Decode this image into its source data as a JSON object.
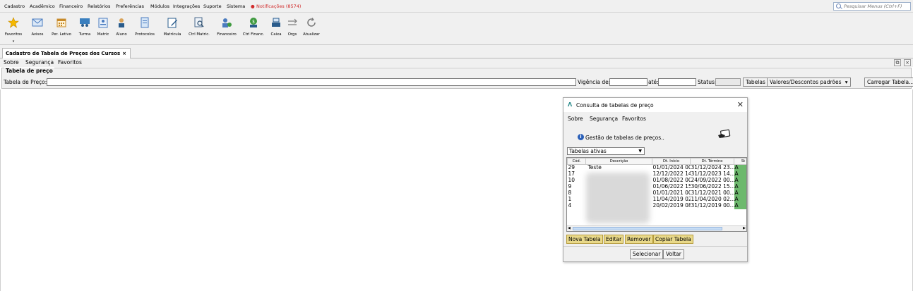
{
  "menubar": {
    "items": [
      "Cadastro",
      "Acadêmico",
      "Financeiro",
      "Relatórios",
      "Preferências",
      "Módulos",
      "Integrações",
      "Suporte",
      "Sistema"
    ],
    "notifications": "Notificações (8574)",
    "search_placeholder": "Pesquisar Menus (Ctrl+F)",
    "notif_color": "#d12b2b"
  },
  "toolbar": {
    "favoritos": "Favoritos",
    "avisos": "Avisos",
    "per_letivo": "Per. Letivo",
    "turma": "Turma",
    "matric": "Matric",
    "aluno": "Aluno",
    "protocolos": "Protocolos",
    "matricula": "Matrícula",
    "ctrl_matric": "Ctrl Matric.",
    "financeiro": "Financeiro",
    "ctrl_financ": "Ctrl Financ.",
    "caixa": "Caixa",
    "orgs": "Orgs",
    "atualizar": "Atualizar"
  },
  "tab": {
    "label": "Cadastro de Tabela de Preços dos Cursos",
    "close": "×"
  },
  "formmenu": {
    "sobre": "Sobre",
    "seguranca": "Segurança",
    "favoritos": "Favoritos"
  },
  "fieldset": {
    "title": "Tabela de preço",
    "tabela_label": "Tabela de Preço:",
    "vigencia_label": "Vigência de:",
    "ate_label": "até:",
    "status_label": "Status:",
    "tabelas_btn": "Tabelas",
    "valores_btn": "Valores/Descontos padrões",
    "carregar_btn": "Carregar Tabela..."
  },
  "dialog": {
    "title": "Consulta de tabelas de preço",
    "menu": {
      "sobre": "Sobre",
      "seguranca": "Segurança",
      "favoritos": "Favoritos"
    },
    "info": "Gestão de tabelas de preços..",
    "filter": "Tabelas ativas",
    "columns": [
      "Cód.",
      "Descrição",
      "Dt. Início",
      "Dt. Término",
      "St"
    ],
    "rows": [
      {
        "cod": "29",
        "desc": "Teste",
        "inicio": "01/01/2024 00...",
        "termino": "31/12/2024 23...",
        "st": "A"
      },
      {
        "cod": "17",
        "desc": "",
        "inicio": "12/12/2022 14...",
        "termino": "31/12/2023 14...",
        "st": "A"
      },
      {
        "cod": "10",
        "desc": "",
        "inicio": "01/08/2022 00...",
        "termino": "24/09/2022 00...",
        "st": "A"
      },
      {
        "cod": "9",
        "desc": "",
        "inicio": "01/06/2022 15...",
        "termino": "30/06/2022 15...",
        "st": "A"
      },
      {
        "cod": "8",
        "desc": "",
        "inicio": "01/01/2021 00...",
        "termino": "31/12/2021 00...",
        "st": "A"
      },
      {
        "cod": "1",
        "desc": "",
        "inicio": "11/04/2019 02...",
        "termino": "11/04/2020 02...",
        "st": "A"
      },
      {
        "cod": "4",
        "desc": "",
        "inicio": "20/02/2019 08...",
        "termino": "31/12/2019 00...",
        "st": "A"
      }
    ],
    "buttons": {
      "nova": "Nova Tabela",
      "editar": "Editar",
      "remover": "Remover",
      "copiar": "Copiar Tabela"
    },
    "selecionar": "Selecionar",
    "voltar": "Voltar",
    "status_color": "#6db96d",
    "action_btn_color": "#e9d98a"
  }
}
